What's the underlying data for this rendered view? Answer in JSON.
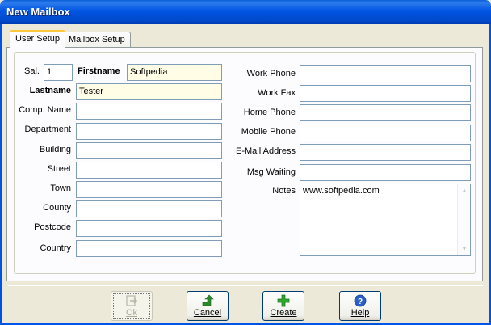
{
  "window": {
    "title": "New Mailbox"
  },
  "tabs": [
    {
      "label": "User Setup"
    },
    {
      "label": "Mailbox Setup"
    }
  ],
  "form_left": {
    "sal_label": "Sal.",
    "sal_value": "1",
    "firstname_label": "Firstname",
    "firstname_value": "Softpedia",
    "lastname_label": "Lastname",
    "lastname_value": "Tester",
    "comp_name_label": "Comp. Name",
    "comp_name_value": "",
    "department_label": "Department",
    "department_value": "",
    "building_label": "Building",
    "building_value": "",
    "street_label": "Street",
    "street_value": "",
    "town_label": "Town",
    "town_value": "",
    "county_label": "County",
    "county_value": "",
    "postcode_label": "Postcode",
    "postcode_value": "",
    "country_label": "Country",
    "country_value": ""
  },
  "form_right": {
    "work_phone_label": "Work Phone",
    "work_phone_value": "",
    "work_fax_label": "Work Fax",
    "work_fax_value": "",
    "home_phone_label": "Home Phone",
    "home_phone_value": "",
    "mobile_phone_label": "Mobile Phone",
    "mobile_phone_value": "",
    "email_label": "E-Mail Address",
    "email_value": "",
    "msg_waiting_label": "Msg Waiting",
    "msg_waiting_value": "",
    "notes_label": "Notes",
    "notes_value": "www.softpedia.com"
  },
  "buttons": {
    "ok": "Ok",
    "cancel": "Cancel",
    "create": "Create",
    "help": "Help"
  },
  "colors": {
    "titlebar": "#0054e3",
    "required_field_bg": "#fffde5",
    "field_border": "#7f9db9",
    "create_icon": "#2da82d",
    "help_icon": "#2a5fc8",
    "cancel_icon": "#2a8a2a"
  },
  "icons": {
    "ok": "ok-arrow-icon",
    "cancel": "cancel-arrow-icon",
    "create": "plus-icon",
    "help": "question-icon"
  }
}
